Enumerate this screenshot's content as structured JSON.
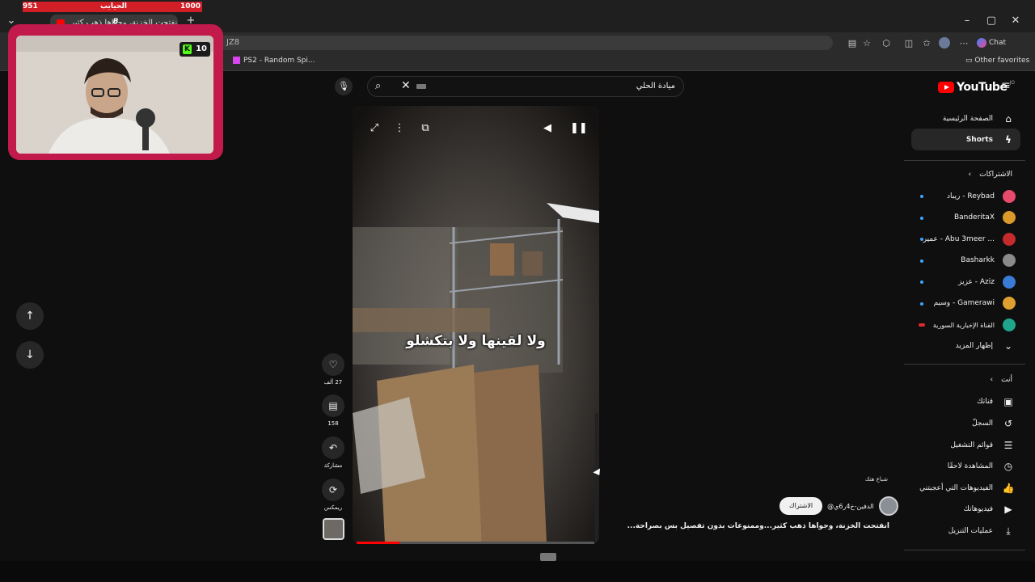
{
  "stream_overlay": {
    "hp_left": "951",
    "hp_title": "الحيايب",
    "hp_right": "1000",
    "counter": "10",
    "cam_letter": "B"
  },
  "browser": {
    "tab_title": "انفتحت الخزنة، وجواها ذهب كثير",
    "url_fragment": "JZ8",
    "bookmarks": [
      {
        "label": "PS2 - Random Spi..."
      }
    ],
    "other_favorites": "Other favorites",
    "chat_label": "Chat"
  },
  "youtube": {
    "logo_text": "YouTube",
    "logo_sup": "JO",
    "search_value": "ميادة الحلي",
    "sidebar": {
      "home": "الصفحة الرئيسية",
      "shorts": "Shorts",
      "subscriptions_header": "الاشتراكات",
      "subscriptions": [
        {
          "label": "ريباد - Reybad",
          "color": "#e84a6c"
        },
        {
          "label": "BanderitaX",
          "color": "#d99a2a"
        },
        {
          "label": "عمير - Abu 3meer ...",
          "color": "#c42b2b"
        },
        {
          "label": "Basharkk",
          "color": "#8a8a8a"
        },
        {
          "label": "عزيز - Aziz",
          "color": "#3a7bd5"
        },
        {
          "label": "وسيم - Gamerawi",
          "color": "#e0a030"
        },
        {
          "label": "القناة الإخبارية السورية",
          "color": "#1fa58b"
        }
      ],
      "show_more": "إظهار المزيد",
      "you_header": "أنت",
      "you_items": [
        {
          "label": "قناتك",
          "icon": "user-icon"
        },
        {
          "label": "السجلّ",
          "icon": "history-icon"
        },
        {
          "label": "قوائم التشغيل",
          "icon": "playlist-icon"
        },
        {
          "label": "المشاهدة لاحقًا",
          "icon": "clock-icon"
        },
        {
          "label": "الفيديوهات التي أعجبتني",
          "icon": "thumbs-up-icon"
        },
        {
          "label": "فيديوهاتك",
          "icon": "video-icon"
        },
        {
          "label": "عمليات التنزيل",
          "icon": "download-icon"
        }
      ]
    },
    "player": {
      "subtitle": "ولا لقينها ولا بتكشلو",
      "progress": 0.18
    },
    "actions": {
      "likes": "27 ألف",
      "comments": "158",
      "share": "مشاركة",
      "remix": "ريمكس"
    },
    "video": {
      "sound_label": "شباع هتك",
      "channel": "@الدفين-خ4ر6ي",
      "subscribe": "الاشتراك",
      "title": "انفتحت الخزنة، وجواها ذهب كثير...وممنوعات بدون تفصيل بس بصراحة..."
    }
  }
}
